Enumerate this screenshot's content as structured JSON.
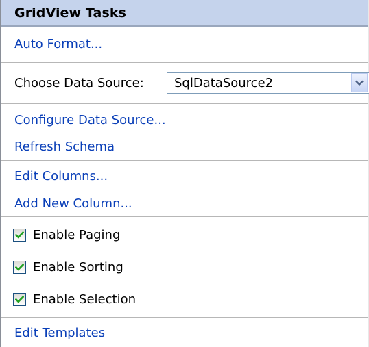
{
  "panel": {
    "title": "GridView Tasks"
  },
  "actions": {
    "auto_format": "Auto Format...",
    "choose_data_source_label": "Choose Data Source:",
    "data_source_value": "SqlDataSource2",
    "configure_data_source": "Configure Data Source...",
    "refresh_schema": "Refresh Schema",
    "edit_columns": "Edit Columns...",
    "add_new_column": "Add New Column...",
    "edit_templates": "Edit Templates"
  },
  "options": [
    {
      "label": "Enable Paging",
      "checked": true
    },
    {
      "label": "Enable Sorting",
      "checked": true
    },
    {
      "label": "Enable Selection",
      "checked": true
    }
  ],
  "colors": {
    "title_bar": "#c5d3ec",
    "link": "#0a3fb8",
    "check_mark": "#21a121"
  },
  "icons": {
    "dropdown": "chevron-down-icon",
    "check": "check-icon"
  }
}
